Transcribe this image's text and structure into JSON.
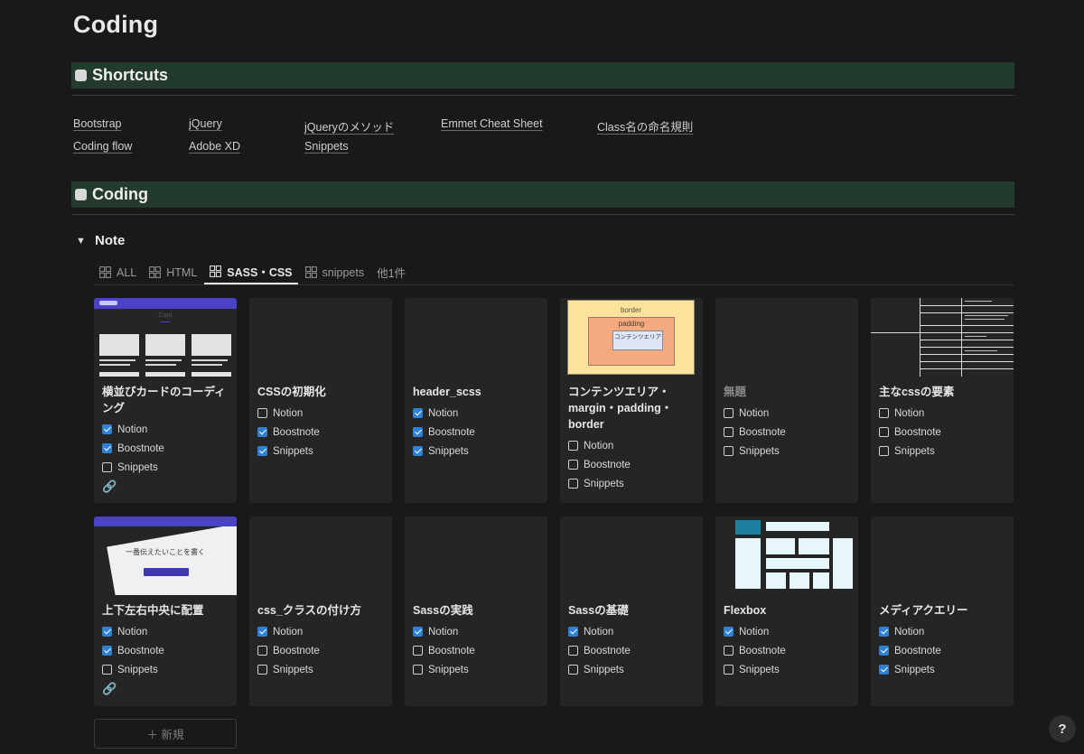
{
  "page": {
    "title": "Coding"
  },
  "sections": {
    "shortcuts": "Shortcuts",
    "coding": "Coding"
  },
  "shortcuts": [
    {
      "label": "Bootstrap"
    },
    {
      "label": "jQuery"
    },
    {
      "label": "jQueryのメソッド"
    },
    {
      "label": "Emmet Cheat Sheet"
    },
    {
      "label": "Class名の命名規則"
    },
    {
      "label": "Coding flow"
    },
    {
      "label": "Adobe XD"
    },
    {
      "label": "Snippets"
    }
  ],
  "note": {
    "title": "Note",
    "tabs": [
      {
        "label": "ALL",
        "active": false
      },
      {
        "label": "HTML",
        "active": false
      },
      {
        "label": "SASS・CSS",
        "active": true
      },
      {
        "label": "snippets",
        "active": false
      },
      {
        "label": "他1件",
        "active": false
      }
    ],
    "property_labels": [
      "Notion",
      "Boostnote",
      "Snippets"
    ],
    "cards": [
      {
        "title": "横並びカードのコーディング",
        "thumb": "card-layout",
        "checks": [
          true,
          true,
          false
        ],
        "has_link": true
      },
      {
        "title": "CSSの初期化",
        "thumb": "none",
        "checks": [
          false,
          true,
          true
        ],
        "has_link": false
      },
      {
        "title": "header_scss",
        "thumb": "none",
        "checks": [
          true,
          true,
          true
        ],
        "has_link": false
      },
      {
        "title": "コンテンツエリア・margin・padding・border",
        "thumb": "box-model",
        "checks": [
          false,
          false,
          false
        ],
        "has_link": false
      },
      {
        "title": "無題",
        "thumb": "none",
        "checks": [
          false,
          false,
          false
        ],
        "has_link": false,
        "untitled": true
      },
      {
        "title": "主なcssの要素",
        "thumb": "table",
        "checks": [
          false,
          false,
          false
        ],
        "has_link": false
      },
      {
        "title": "上下左右中央に配置",
        "thumb": "hero",
        "checks": [
          true,
          true,
          false
        ],
        "has_link": true
      },
      {
        "title": "css_クラスの付け方",
        "thumb": "none",
        "checks": [
          true,
          false,
          false
        ],
        "has_link": false
      },
      {
        "title": "Sassの実践",
        "thumb": "none",
        "checks": [
          true,
          false,
          false
        ],
        "has_link": false
      },
      {
        "title": "Sassの基礎",
        "thumb": "none",
        "checks": [
          true,
          false,
          false
        ],
        "has_link": false
      },
      {
        "title": "Flexbox",
        "thumb": "flexbox",
        "checks": [
          true,
          false,
          false
        ],
        "has_link": false
      },
      {
        "title": "メディアクエリー",
        "thumb": "none",
        "checks": [
          true,
          true,
          true
        ],
        "has_link": false
      }
    ],
    "thumb_text": {
      "card_heading": "Card",
      "box_border": "border",
      "box_padding": "padding",
      "box_content": "コンテンツエリア",
      "hero_heading": "一番伝えたいことを書く"
    },
    "new_button": "＋ 新規"
  },
  "help": {
    "label": "?"
  },
  "colors": {
    "background": "#191919",
    "section_band": "#233b2c",
    "card": "#252525",
    "checkbox_checked": "#2e82d6"
  }
}
